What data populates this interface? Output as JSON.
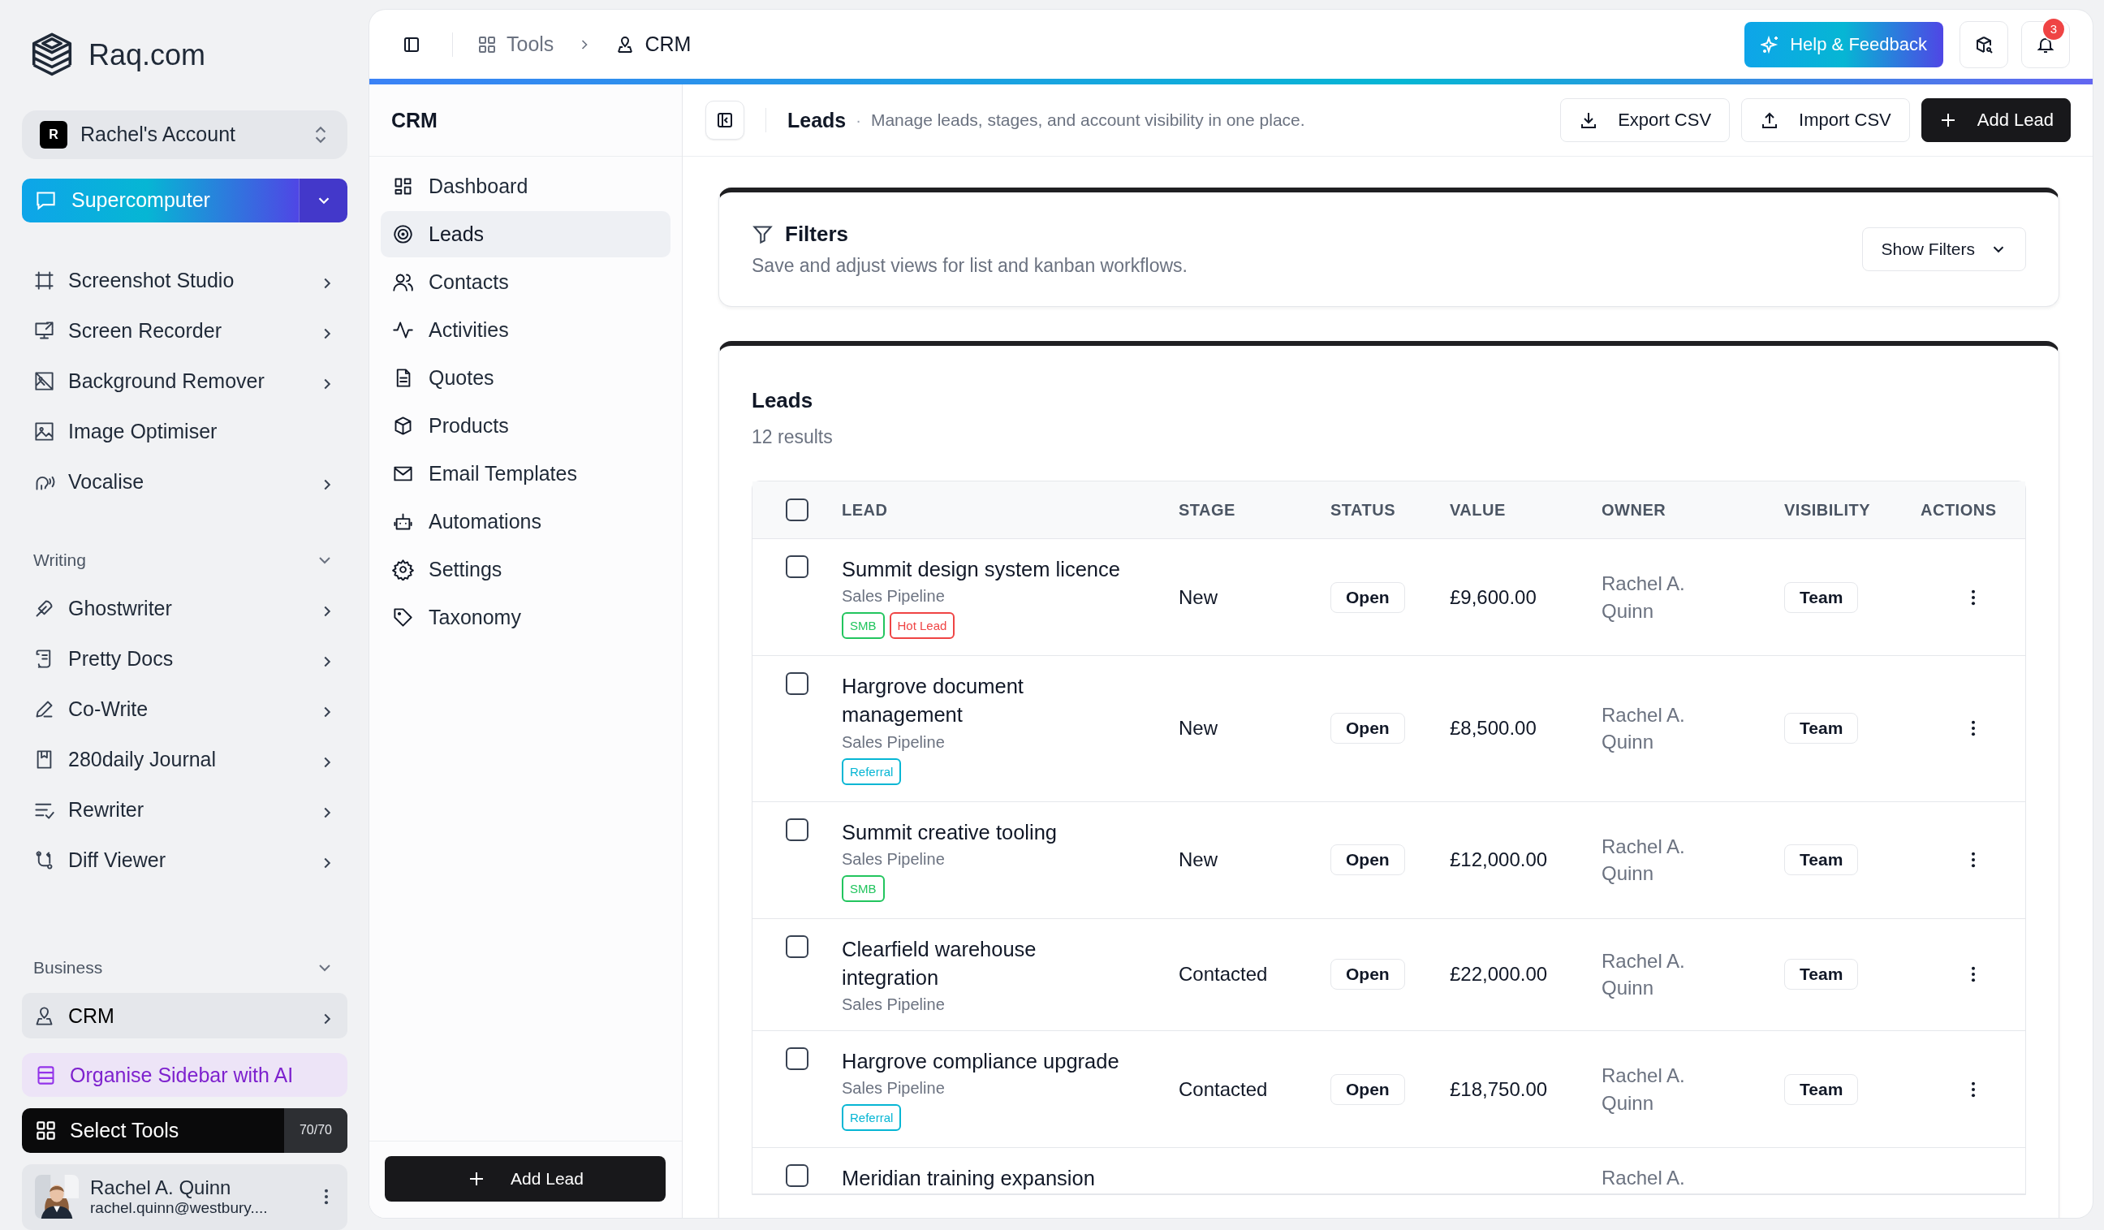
{
  "brand": {
    "name": "Raq.com"
  },
  "account": {
    "initial": "R",
    "name": "Rachel's Account"
  },
  "featured": {
    "label": "Supercomputer"
  },
  "sidebar_sections": [
    {
      "items": [
        {
          "label": "Screenshot Studio",
          "has_submenu": true,
          "selected": false
        },
        {
          "label": "Screen Recorder",
          "has_submenu": true,
          "selected": false
        },
        {
          "label": "Background Remover",
          "has_submenu": true,
          "selected": false
        },
        {
          "label": "Image Optimiser",
          "has_submenu": false,
          "selected": false
        },
        {
          "label": "Vocalise",
          "has_submenu": true,
          "selected": false
        }
      ]
    },
    {
      "title": "Writing",
      "expanded": true,
      "items": [
        {
          "label": "Ghostwriter",
          "has_submenu": true,
          "selected": false
        },
        {
          "label": "Pretty Docs",
          "has_submenu": true,
          "selected": false
        },
        {
          "label": "Co-Write",
          "has_submenu": true,
          "selected": false
        },
        {
          "label": "280daily Journal",
          "has_submenu": true,
          "selected": false
        },
        {
          "label": "Rewriter",
          "has_submenu": true,
          "selected": false
        },
        {
          "label": "Diff Viewer",
          "has_submenu": true,
          "selected": false
        }
      ]
    },
    {
      "title": "Business",
      "expanded": true,
      "items": [
        {
          "label": "CRM",
          "has_submenu": true,
          "selected": true
        }
      ]
    }
  ],
  "organise": {
    "label": "Organise Sidebar with AI"
  },
  "select_tools": {
    "label": "Select Tools",
    "count": "70/70"
  },
  "user": {
    "name": "Rachel A. Quinn",
    "email": "rachel.quinn@westbury...."
  },
  "topbar": {
    "breadcrumbs": [
      "Tools",
      "CRM"
    ],
    "help_button": "Help & Feedback",
    "notification_count": "3"
  },
  "crm_nav": {
    "title": "CRM",
    "items": [
      {
        "label": "Dashboard",
        "selected": false
      },
      {
        "label": "Leads",
        "selected": true
      },
      {
        "label": "Contacts",
        "selected": false
      },
      {
        "label": "Activities",
        "selected": false
      },
      {
        "label": "Quotes",
        "selected": false
      },
      {
        "label": "Products",
        "selected": false
      },
      {
        "label": "Email Templates",
        "selected": false
      },
      {
        "label": "Automations",
        "selected": false
      },
      {
        "label": "Settings",
        "selected": false
      },
      {
        "label": "Taxonomy",
        "selected": false
      }
    ],
    "add_button": "Add Lead"
  },
  "page_header": {
    "title": "Leads",
    "separator": "·",
    "description": "Manage leads, stages, and account visibility in one place.",
    "actions": [
      {
        "label": "Export CSV",
        "kind": "export"
      },
      {
        "label": "Import CSV",
        "kind": "import"
      },
      {
        "label": "Add Lead",
        "kind": "primary"
      }
    ]
  },
  "filters": {
    "title": "Filters",
    "description": "Save and adjust views for list and kanban workflows.",
    "button": "Show Filters"
  },
  "leads": {
    "title": "Leads",
    "count": "12 results",
    "all_checked": false,
    "columns": [
      "LEAD",
      "STAGE",
      "STATUS",
      "VALUE",
      "OWNER",
      "VISIBILITY",
      "ACTIONS"
    ],
    "rows": [
      {
        "kind": "full",
        "checked": false,
        "lead": "Summit design system licence",
        "pipeline": "Sales Pipeline",
        "tags": [
          {
            "label": "SMB",
            "color": "#22c55e"
          },
          {
            "label": "Hot Lead",
            "color": "#ef4444"
          }
        ],
        "stage": "New",
        "status": "Open",
        "value": "£9,600.00",
        "owner": "Rachel A. Quinn",
        "visibility": "Team"
      },
      {
        "kind": "full",
        "checked": false,
        "lead": "Hargrove document management",
        "pipeline": "Sales Pipeline",
        "tags": [
          {
            "label": "Referral",
            "color": "#06b6d4"
          }
        ],
        "stage": "New",
        "status": "Open",
        "value": "£8,500.00",
        "owner": "Rachel A. Quinn",
        "visibility": "Team"
      },
      {
        "kind": "full",
        "checked": false,
        "lead": "Summit creative tooling",
        "pipeline": "Sales Pipeline",
        "tags": [
          {
            "label": "SMB",
            "color": "#22c55e"
          }
        ],
        "stage": "New",
        "status": "Open",
        "value": "£12,000.00",
        "owner": "Rachel A. Quinn",
        "visibility": "Team"
      },
      {
        "kind": "full",
        "checked": false,
        "lead": "Clearfield warehouse integration",
        "pipeline": "Sales Pipeline",
        "stage": "Contacted",
        "status": "Open",
        "value": "£22,000.00",
        "owner": "Rachel A. Quinn",
        "visibility": "Team"
      },
      {
        "kind": "full",
        "checked": false,
        "lead": "Hargrove compliance upgrade",
        "pipeline": "Sales Pipeline",
        "tags": [
          {
            "label": "Referral",
            "color": "#06b6d4"
          }
        ],
        "stage": "Contacted",
        "status": "Open",
        "value": "£18,750.00",
        "owner": "Rachel A. Quinn",
        "visibility": "Team"
      },
      {
        "kind": "partial",
        "checked": false,
        "lead": "Meridian training expansion",
        "owner": "Rachel A."
      }
    ]
  }
}
